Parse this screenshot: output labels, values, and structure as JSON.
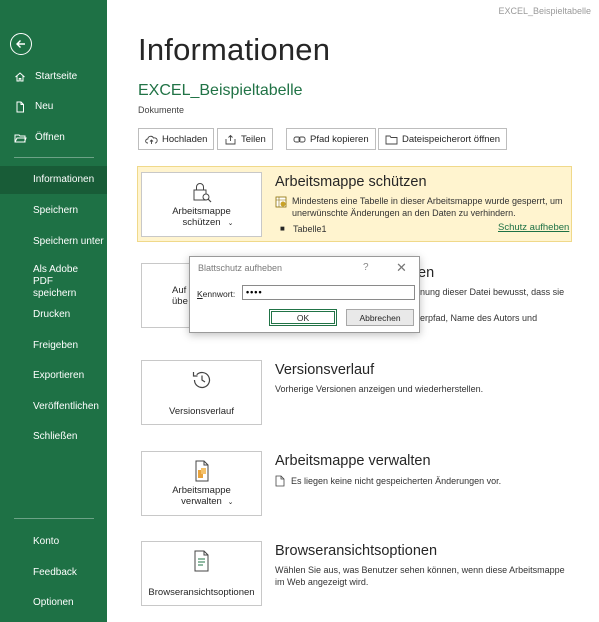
{
  "window": {
    "title": "EXCEL_Beispieltabelle"
  },
  "sidebar": {
    "top_items": [
      {
        "label": "Startseite",
        "icon": "home-icon"
      },
      {
        "label": "Neu",
        "icon": "new-file-icon"
      },
      {
        "label": "Öffnen",
        "icon": "folder-open-icon"
      }
    ],
    "middle_items": [
      {
        "label": "Informationen",
        "active": true
      },
      {
        "label": "Speichern"
      },
      {
        "label": "Speichern unter"
      },
      {
        "label": "Als Adobe PDF speichern"
      },
      {
        "label": "Drucken"
      },
      {
        "label": "Freigeben"
      },
      {
        "label": "Exportieren"
      },
      {
        "label": "Veröffentlichen"
      },
      {
        "label": "Schließen"
      }
    ],
    "bottom_items": [
      {
        "label": "Konto"
      },
      {
        "label": "Feedback"
      },
      {
        "label": "Optionen"
      }
    ],
    "accent": "#1e7145"
  },
  "main": {
    "title": "Informationen",
    "doc_name": "EXCEL_Beispieltabelle",
    "doc_location": "Dokumente",
    "actions": [
      {
        "label": "Hochladen",
        "icon": "upload-icon"
      },
      {
        "label": "Teilen",
        "icon": "share-icon"
      },
      {
        "label": "Pfad kopieren",
        "icon": "copy-link-icon"
      },
      {
        "label": "Dateispeicherort öffnen",
        "icon": "folder-icon"
      }
    ],
    "protect": {
      "tile_label": "Arbeitsmappe schützen",
      "title": "Arbeitsmappe schützen",
      "text": "Mindestens eine Tabelle in dieser Arbeitsmappe wurde gesperrt, um unerwünschte Änderungen an den Daten zu verhindern.",
      "sheet": "Tabelle1",
      "unprotect_link": "Schutz aufheben",
      "bg": "#fff4cf"
    },
    "inspect": {
      "tile_label_partial_1": "Auf",
      "tile_label_partial_2": "übe",
      "title_partial": "en",
      "text_partial_1": "nung dieser Datei bewusst, dass sie",
      "text_partial_2": "erpfad, Name des Autors und"
    },
    "versions": {
      "tile_label": "Versionsverlauf",
      "title": "Versionsverlauf",
      "text": "Vorherige Versionen anzeigen und wiederherstellen."
    },
    "manage": {
      "tile_label": "Arbeitsmappe verwalten",
      "title": "Arbeitsmappe verwalten",
      "text": "Es liegen keine nicht gespeicherten Änderungen vor."
    },
    "browser": {
      "tile_label": "Browseransichtsoptionen",
      "title": "Browseransichtsoptionen",
      "text": "Wählen Sie aus, was Benutzer sehen können, wenn diese Arbeitsmappe im Web angezeigt wird."
    }
  },
  "dialog": {
    "title": "Blattschutz aufheben",
    "help": "?",
    "close": "✕",
    "password_label": "Kennwort:",
    "password_value": "••••",
    "ok_label": "OK",
    "cancel_label": "Abbrechen"
  }
}
